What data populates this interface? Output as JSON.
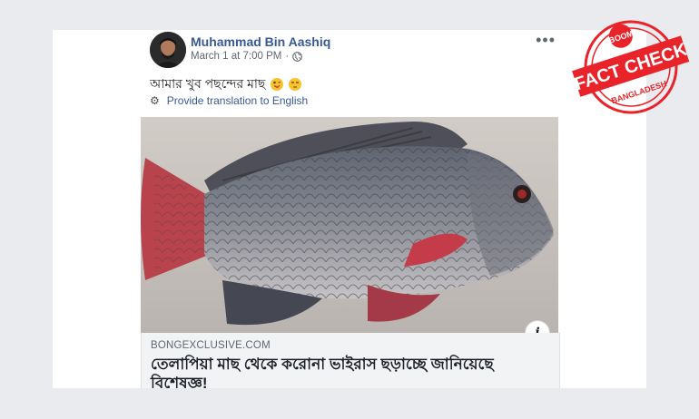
{
  "post": {
    "author": "Muhammad Bin Aashiq",
    "timestamp": "March 1 at 7:00 PM",
    "audience_icon": "globe-icon",
    "more_label": "•••",
    "message": "আমার খুব পছন্দের মাছ",
    "message_emojis": [
      "tongue-wink-emoji",
      "unamused-emoji"
    ],
    "translate_label": "Provide translation to English"
  },
  "link": {
    "domain": "BONGEXCLUSIVE.COM",
    "title": "তেলাপিয়া মাছ থেকে করোনা ভাইরাস ছড়াচ্ছে জানিয়েছে বিশেষজ্ঞ!",
    "info_label": "i"
  },
  "stamp": {
    "top_text": "BOOM",
    "main_text": "FACT CHECK",
    "bottom_text": "BANGLADESH",
    "color": "#e8232a"
  }
}
